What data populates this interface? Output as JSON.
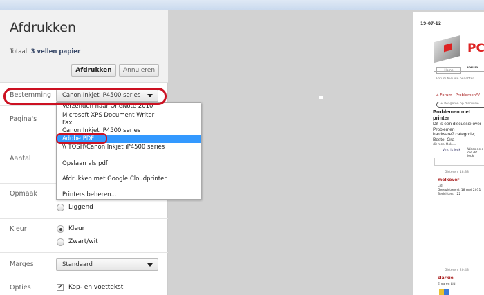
{
  "dialog": {
    "title": "Afdrukken",
    "total_label": "Totaal:",
    "total_value": "3 vellen papier",
    "print_button": "Afdrukken",
    "cancel_button": "Annuleren"
  },
  "settings": {
    "destination": {
      "label": "Bestemming",
      "value": "Canon Inkjet iP4500 series"
    },
    "pages": {
      "label": "Pagina's"
    },
    "copies": {
      "label": "Aantal"
    },
    "layout": {
      "label": "Opmaak",
      "options": [
        "Liggend"
      ]
    },
    "color": {
      "label": "Kleur",
      "options": [
        "Kleur",
        "Zwart/wit"
      ],
      "selected": "Kleur"
    },
    "margins": {
      "label": "Marges",
      "value": "Standaard"
    },
    "options": {
      "label": "Opties",
      "checkbox": "Kop- en voettekst",
      "checked": true
    }
  },
  "dropdown": {
    "items": [
      "Verzenden naar OneNote 2010",
      "Microsoft XPS Document Writer",
      "Fax",
      "Canon Inkjet iP4500 series",
      "Adobe PDF",
      "\\\\           TOSH\\Canon Inkjet iP4500 series",
      "Opslaan als pdf",
      "Afdrukken met Google Cloudprinter",
      "Printers beheren..."
    ],
    "highlighted": "Adobe PDF"
  },
  "preview": {
    "date": "19-07-12",
    "logo": "PC",
    "tabs": [
      "Home",
      "Forum"
    ],
    "breadcrumb": "Forum  Nieuwe berichten",
    "nav": [
      "Forum",
      "Problemen/V"
    ],
    "reply": "+ Reageren op discussie",
    "thread_title": "Problemen met printer",
    "thread_text": [
      "Dit is een discussie over Problemen",
      "hardware? categorie; Beste, Gra",
      "dit niet. Ook...."
    ],
    "like": "Vind ik leuk",
    "like_note": "Wees de e die dit leuk",
    "posts": [
      {
        "time": "Gisteren, 18:38",
        "user": "melkever",
        "rank": "Lid",
        "registered_label": "Geregistreerd:",
        "registered": "18 mei 2011",
        "posts_label": "Berichten:",
        "posts": "22"
      },
      {
        "time": "Gisteren, 20:43",
        "user": "clarkie",
        "rank": "Ervaren Lid"
      }
    ]
  },
  "colors": {
    "highlight": "#3399ff",
    "annotation": "#cc1122"
  }
}
